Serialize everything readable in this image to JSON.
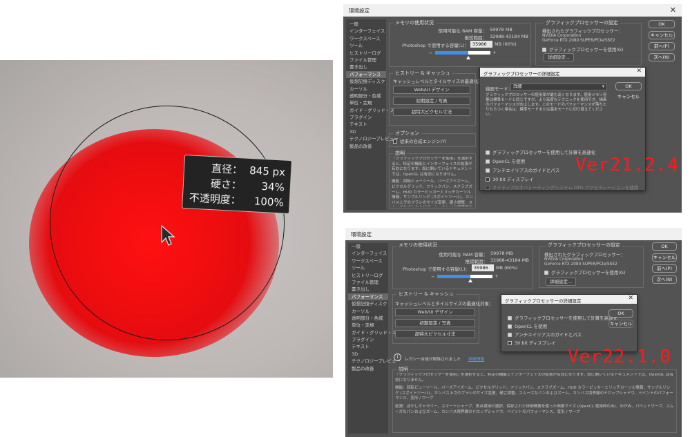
{
  "photo": {
    "tooltip": {
      "diameter_label": "直径：",
      "diameter_value": "845 px",
      "hardness_label": "硬さ：",
      "hardness_value": "34%",
      "opacity_label": "不透明度：",
      "opacity_value": "100%"
    }
  },
  "common": {
    "window_title": "環境設定",
    "sidebar_items": [
      "一般",
      "インターフェイス",
      "ワークスペース",
      "ツール",
      "ヒストリーログ",
      "ファイル管理",
      "書き出し",
      "パフォーマンス",
      "仮想記憶ディスク",
      "カーソル",
      "透明部分・色域",
      "単位・定規",
      "ガイド・グリッド・スライス",
      "プラグイン",
      "テキスト",
      "3D",
      "テクノロジープレビュー",
      "製品の改善"
    ],
    "memory": {
      "title": "メモリの使用状況",
      "available_label": "使用可能な RAM 容量：",
      "available_value": "59978 MB",
      "ideal_label": "推奨範囲：",
      "ideal_value": "32988-43184 MB",
      "use_label": "Photoshop で使用する容量(L)：",
      "use_value": "35986",
      "use_unit": "MB (60%)",
      "slider_percent": 60,
      "minus": "−",
      "plus": "+"
    },
    "gpu": {
      "title": "グラフィックプロセッサーの設定",
      "detected_label": "検出されたグラフィックプロセッサー：",
      "vendor": "NVIDIA Corporation",
      "model": "GeForce RTX 2080 SUPER/PCIe/SSE2",
      "use_gpu": "グラフィックプロセッサーを使用(G)",
      "advanced_button": "詳細設定..."
    },
    "history": {
      "title": "ヒストリー & キャッシュ",
      "optimize_label": "キャッシュレベルとタイルサイズの最適化対象：",
      "btn_web": "Web/UI デザイン",
      "btn_default": "初期設定 / 写真",
      "btn_huge": "超特大ピクセル寸法"
    },
    "buttons": {
      "ok": "OK",
      "cancel": "キャンセル",
      "prev": "前へ(P)",
      "next": "次へ(N)"
    },
    "description": {
      "title": "説明",
      "body_1": "「グラフィックプロセッサーを使用」を選択すると、特定の機能とインターフェイスの拡張が有効になります。既に開いているドキュメントでは、OpenGL は有効になりません。",
      "body_2": "機能：回転ビューツール、バーズアイズーム、ピクセルグリッド、フリックパン、スクラブズーム、HUD カラーピッカーとリッチカーソル情報、サンプルリング (スポイトツール)、カンバス上でのブラシのサイズ変更、硬さ調整、スムーズなパンおよびズーム、カンバス境界線のドロップシャドウ、ペイントのパフォーマンス、変形 / ワープ",
      "body_3": "拡張：ぼかしギャラリー、スマートシャープ、焦点領域の選択、保存された詳細情報を使った画像サイズ (OpenCL 使用時のみ)、ゆがみ、パペットワープ、スムーズなパンおよびズーム、カンバス境界線のドロップシャドウ、ペイントのパフォーマンス、変形 / ワープ"
    }
  },
  "v1": {
    "options_title": "オプション",
    "legacy_compositing": "従来の合成エンジン(Y)",
    "subdialog": {
      "title": "グラフィックプロセッサーの詳細設定",
      "mode_label": "描画モード：",
      "mode_value": "詳細",
      "mode_desc": "グラフィックプロセッサーの使用率が最も高くなります。使用メモリ容量は標準モードと同じですが、より高度なテクニックを使用でき、描画のパフォーマンスが向上します。このモードのパフォーマンスが落ちたりちらつく場合は、標準モードまたは基本モードに切り替えてください。",
      "ok": "OK",
      "cancel": "キャンセル",
      "opt_gpu_compute": "グラフィックプロセッサーを使用して計算を高速化",
      "opt_opencl": "OpenCL を使用",
      "opt_antialias": "アンチエイリアスのガイドとパス",
      "opt_30bit": "30 bit ディスプレイ",
      "opt_native": "ネイティブのオペレーティングシステム GPU アクセラレーションを使用"
    },
    "version_label": "Ver21.2.4"
  },
  "v2": {
    "legacy_notice": "レガシー合成が削除されました",
    "learn_more": "詳細情報",
    "subdialog": {
      "title": "グラフィックプロセッサーの詳細設定",
      "ok": "OK",
      "cancel": "キャンセル",
      "opt_gpu_compute": "グラフィックプロセッサーを使用して計算を高速化",
      "opt_opencl": "OpenCL を使用",
      "opt_antialias": "アンチエイリアスのガイドとパス",
      "opt_30bit": "30 bit ディスプレイ"
    },
    "version_label": "Ver22.1.0"
  }
}
